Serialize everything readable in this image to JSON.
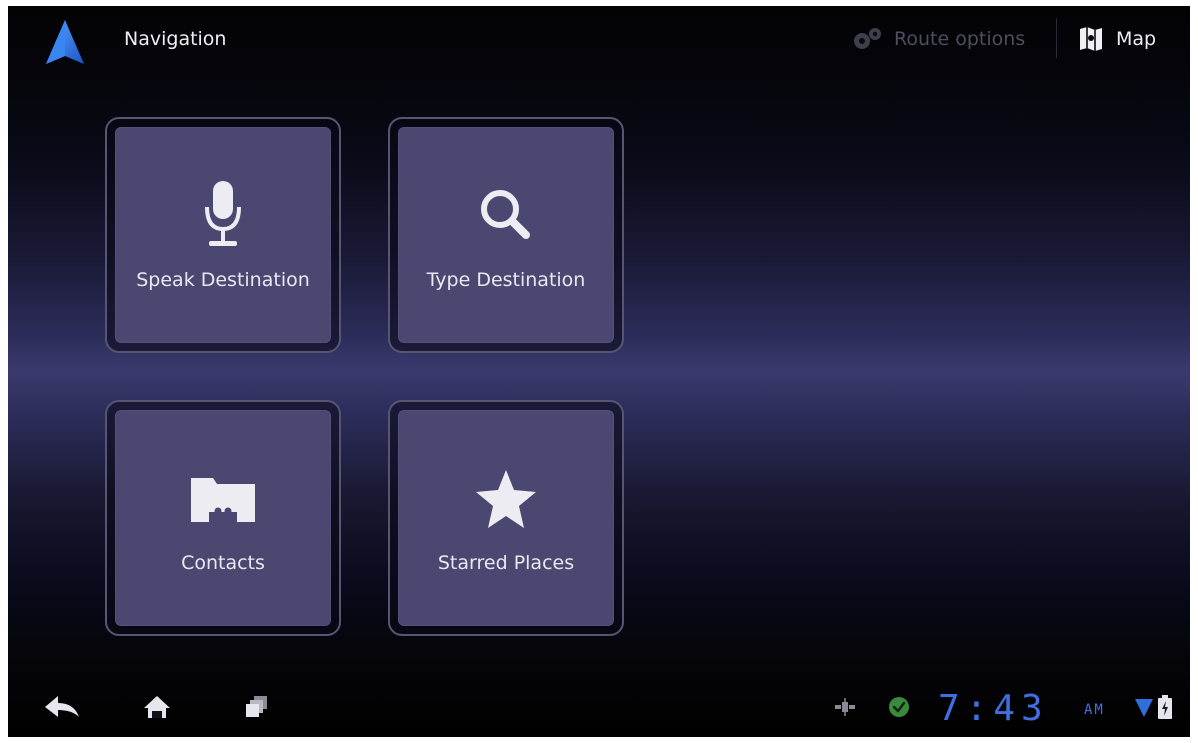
{
  "action_bar": {
    "title": "Navigation",
    "route_options_label": "Route options",
    "map_label": "Map"
  },
  "tiles": [
    {
      "label": "Speak Destination",
      "icon": "microphone-icon"
    },
    {
      "label": "Type Destination",
      "icon": "search-icon"
    },
    {
      "label": "Contacts",
      "icon": "contacts-folder-icon"
    },
    {
      "label": "Starred Places",
      "icon": "star-icon"
    }
  ],
  "system_bar": {
    "time": "7:43",
    "ampm": "AM"
  },
  "colors": {
    "accent": "#2f6fdc",
    "tile_fill": "#4a4870",
    "clock": "#3f6fe0",
    "security_green": "#3a8a3e"
  }
}
